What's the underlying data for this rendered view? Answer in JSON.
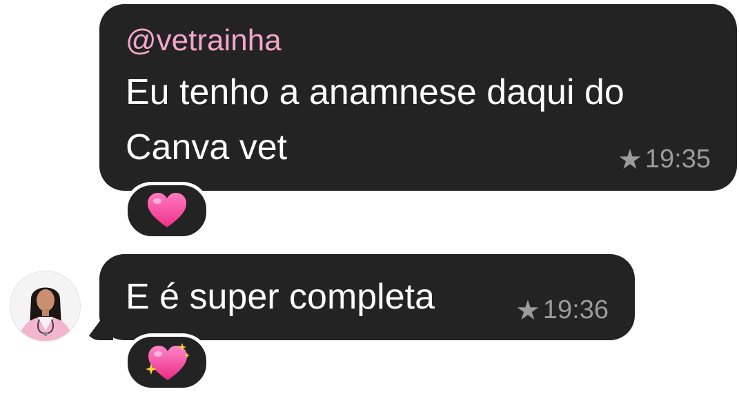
{
  "messages": [
    {
      "sender": "@vetrainha",
      "text": "Eu tenho a anamnese daqui do Canva vet",
      "star": "★",
      "time": "19:35",
      "reaction": "pink-heart"
    },
    {
      "text": "E é super completa",
      "star": "★",
      "time": "19:36",
      "reaction": "sparkling-heart"
    }
  ],
  "colors": {
    "bubble": "#232323",
    "sender": "#f4a6c5",
    "meta": "#9b9b9b",
    "heart": "#ff4fa3",
    "sparkle": "#ffd23a"
  }
}
